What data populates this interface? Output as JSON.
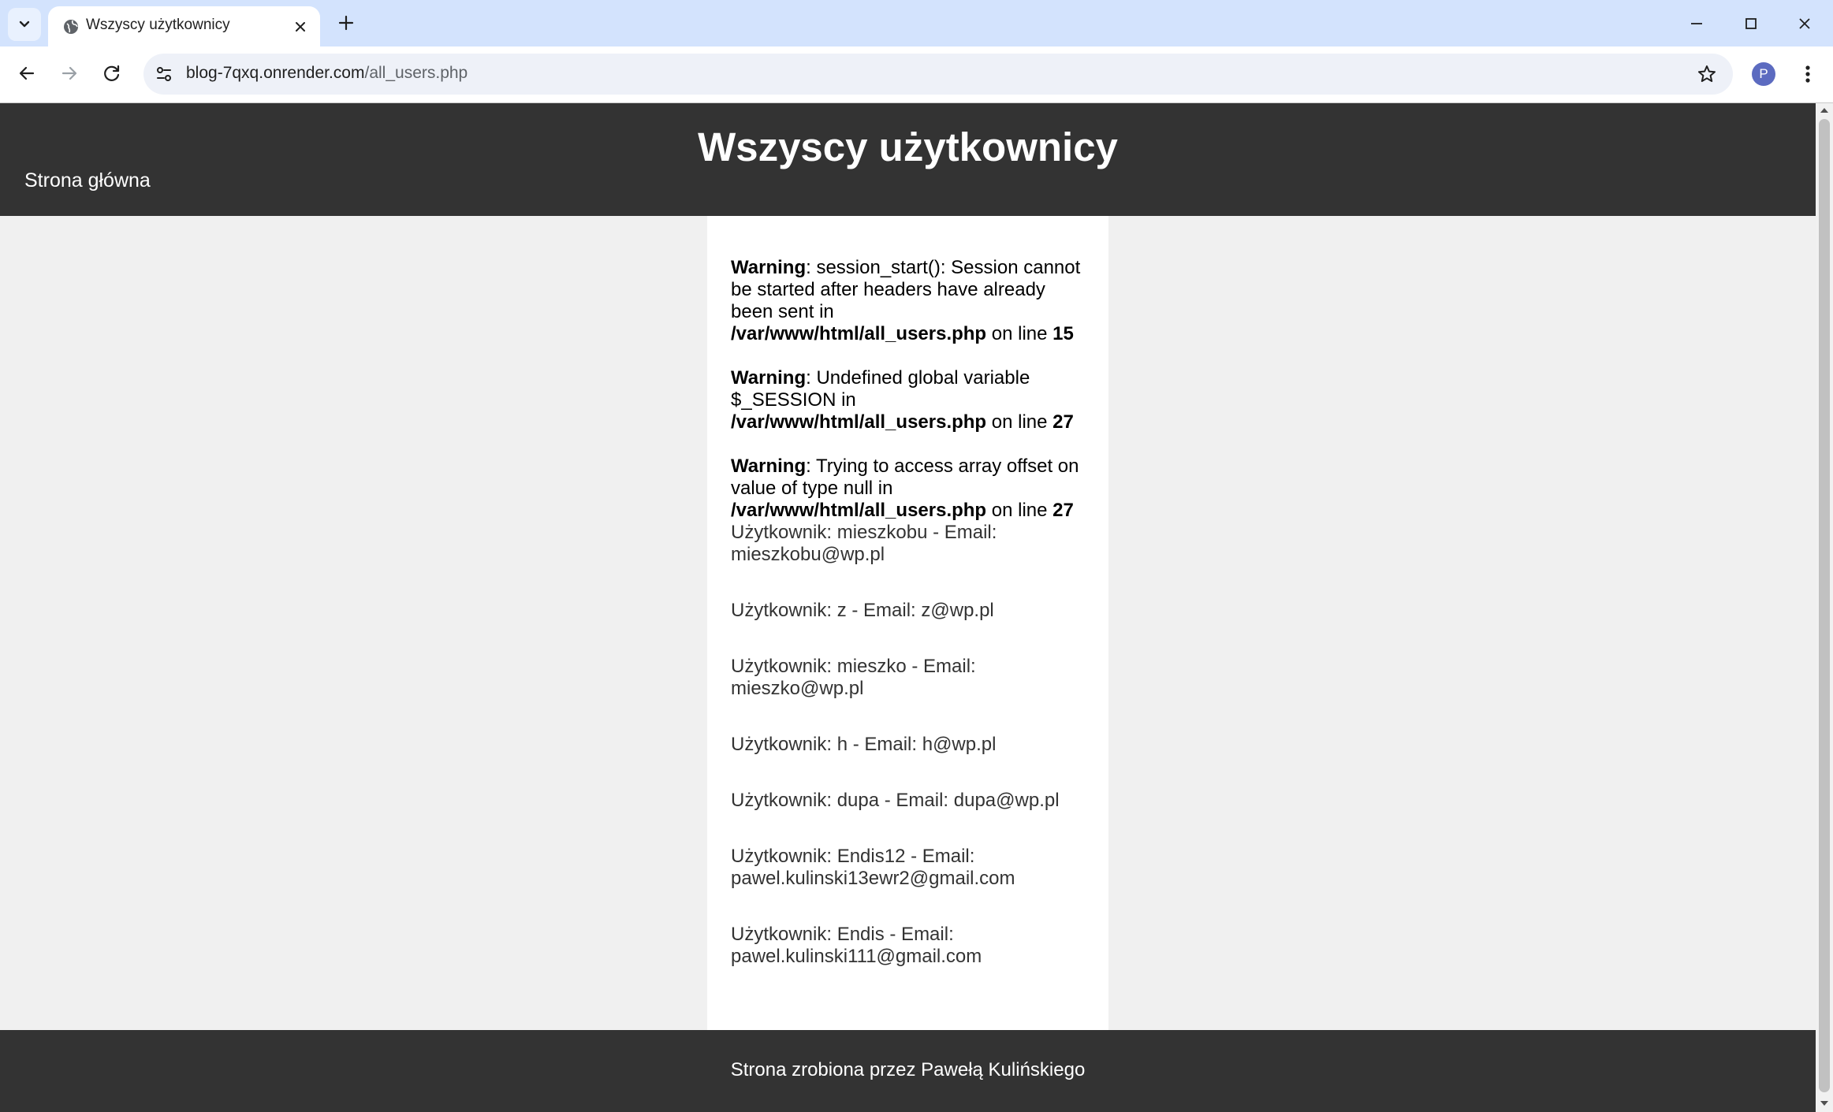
{
  "browser": {
    "tab_title": "Wszyscy użytkownicy",
    "url_host": "blog-7qxq.onrender.com",
    "url_path": "/all_users.php",
    "profile_initial": "P",
    "accent_color": "#d3e3fd"
  },
  "page": {
    "title": "Wszyscy użytkownicy",
    "home_link": "Strona główna",
    "warnings": [
      {
        "label": "Warning",
        "message": ": session_start(): Session cannot be started after headers have already been sent in ",
        "file": "/var/www/html/all_users.php",
        "on_line": " on line ",
        "line": "15"
      },
      {
        "label": "Warning",
        "message": ": Undefined global variable $_SESSION in ",
        "file": "/var/www/html/all_users.php",
        "on_line": " on line ",
        "line": "27"
      },
      {
        "label": "Warning",
        "message": ": Trying to access array offset on value of type null in ",
        "file": "/var/www/html/all_users.php",
        "on_line": " on line ",
        "line": "27"
      }
    ],
    "users": [
      "Użytkownik: mieszkobu - Email: mieszkobu@wp.pl",
      "Użytkownik: z - Email: z@wp.pl",
      "Użytkownik: mieszko - Email: mieszko@wp.pl",
      "Użytkownik: h - Email: h@wp.pl",
      "Użytkownik: dupa - Email: dupa@wp.pl",
      "Użytkownik: Endis12 - Email: pawel.kulinski13ewr2@gmail.com",
      "Użytkownik: Endis - Email: pawel.kulinski111@gmail.com"
    ],
    "footer": "Strona zrobiona przez Pawełą Kulińskiego",
    "header_color": "#333333",
    "background_color": "#f0f0f0"
  }
}
